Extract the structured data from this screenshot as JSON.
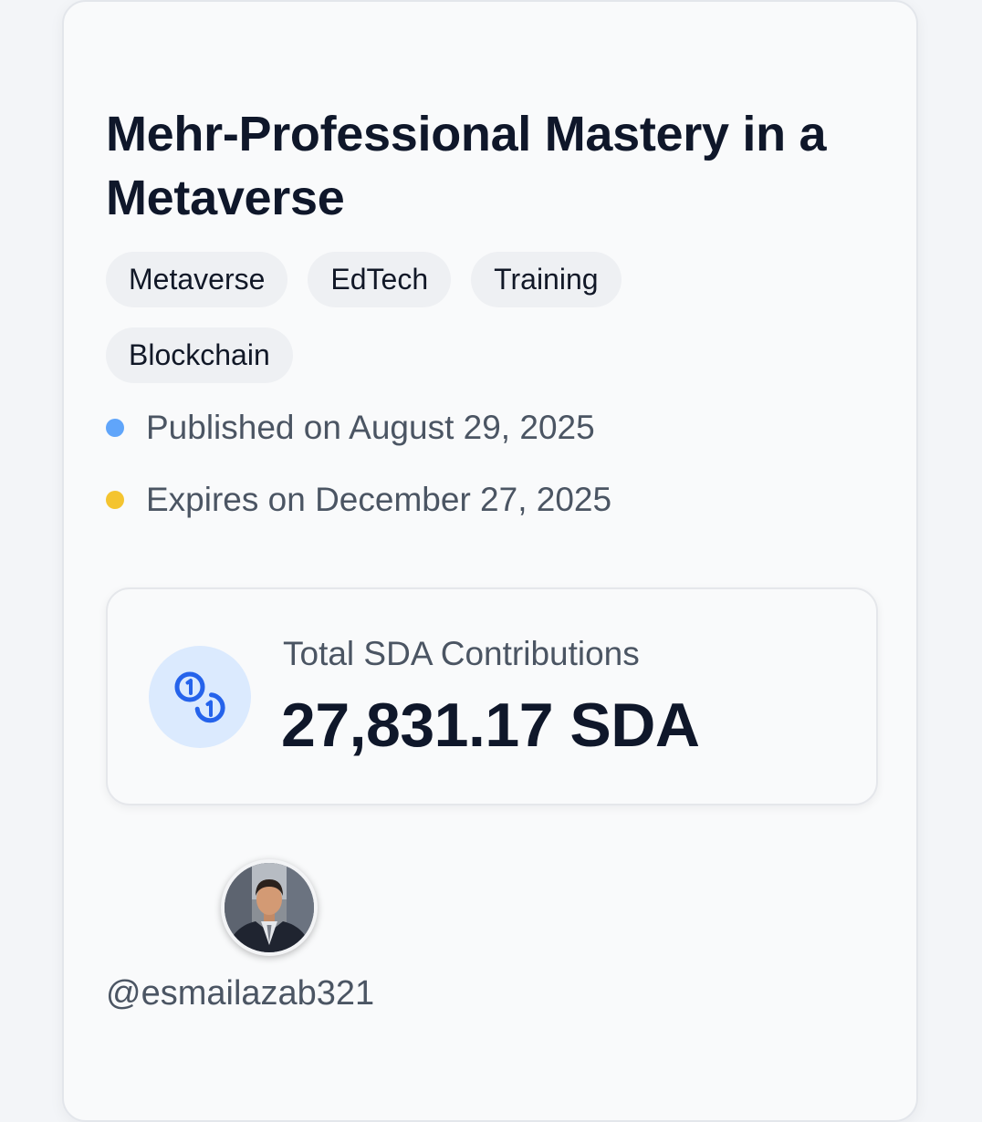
{
  "project": {
    "title": "Mehr-Professional Mastery in a Metaverse",
    "tags": [
      "Metaverse",
      "EdTech",
      "Training",
      "Blockchain"
    ],
    "published": {
      "text": "Published on August 29, 2025",
      "color": "#60a5fa"
    },
    "expires": {
      "text": "Expires on December 27, 2025",
      "color": "#f4c430"
    }
  },
  "contributions": {
    "label": "Total SDA Contributions",
    "value": "27,831.17 SDA",
    "icon": "coins-icon",
    "icon_color": "#2563eb",
    "icon_bg": "#dbeafe"
  },
  "author": {
    "username": "@esmailazab321",
    "avatar": "avatar-photo"
  }
}
